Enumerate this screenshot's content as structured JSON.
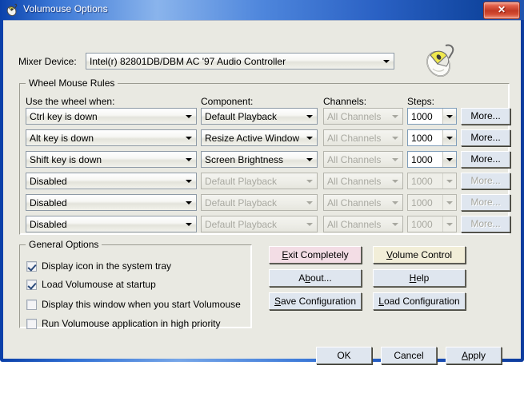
{
  "window": {
    "title": "Volumouse Options",
    "title_icon": "mouse-icon",
    "close_label": "✕"
  },
  "mixer": {
    "label": "Mixer Device:",
    "value": "Intel(r) 82801DB/DBM AC '97 Audio Controller"
  },
  "rules_group": {
    "title": "Wheel Mouse Rules",
    "headers": {
      "wheel": "Use the wheel when:",
      "component": "Component:",
      "channels": "Channels:",
      "steps": "Steps:"
    },
    "more_label": "More...",
    "rows": [
      {
        "wheel": "Ctrl key is down",
        "component": "Default Playback",
        "channels": "All Channels",
        "steps": "1000",
        "enabled": true
      },
      {
        "wheel": "Alt key is down",
        "component": "Resize Active Window",
        "channels": "All Channels",
        "steps": "1000",
        "enabled": true
      },
      {
        "wheel": "Shift key is down",
        "component": "Screen Brightness",
        "channels": "All Channels",
        "steps": "1000",
        "enabled": true
      },
      {
        "wheel": "Disabled",
        "component": "Default Playback",
        "channels": "All Channels",
        "steps": "1000",
        "enabled": false
      },
      {
        "wheel": "Disabled",
        "component": "Default Playback",
        "channels": "All Channels",
        "steps": "1000",
        "enabled": false
      },
      {
        "wheel": "Disabled",
        "component": "Default Playback",
        "channels": "All Channels",
        "steps": "1000",
        "enabled": false
      }
    ]
  },
  "general_group": {
    "title": "General Options",
    "checkboxes": [
      {
        "label": "Display icon in the system tray",
        "checked": true
      },
      {
        "label": "Load Volumouse at startup",
        "checked": true
      },
      {
        "label": "Display this window when you start Volumouse",
        "checked": false
      },
      {
        "label": "Run Volumouse application in high priority",
        "checked": false
      }
    ]
  },
  "action_buttons": {
    "exit_completely": "Exit Completely",
    "volume_control": "Volume Control",
    "about": "About...",
    "help": "Help",
    "save_configuration": "Save Configuration",
    "load_configuration": "Load Configuration"
  },
  "dialog_buttons": {
    "ok": "OK",
    "cancel": "Cancel",
    "apply": "Apply"
  },
  "colors": {
    "titlebar_blue": "#2f6fd4",
    "close_red": "#c23a25",
    "client_bg": "#e9e9e2",
    "exit_pink": "#f3dde5",
    "volume_cream": "#f2eed8",
    "button_blue": "#dfe6ef",
    "disabled_text": "#a8a8a0"
  }
}
